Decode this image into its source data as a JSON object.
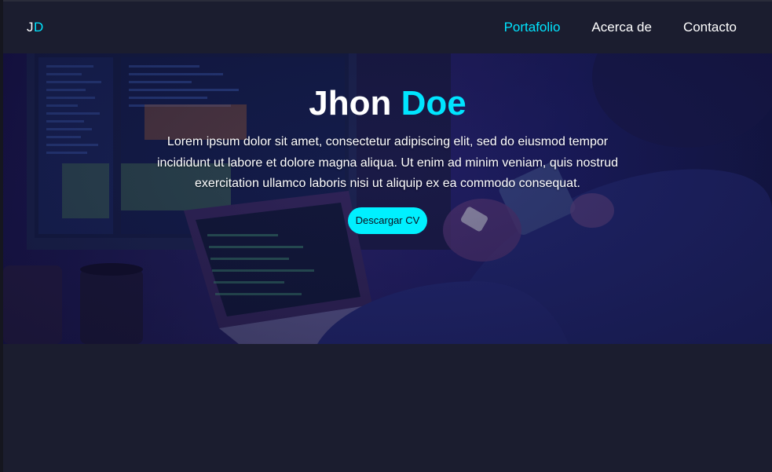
{
  "nav": {
    "logo_first": "J",
    "logo_second": "D",
    "links": [
      {
        "label": "Portafolio",
        "active": true
      },
      {
        "label": "Acerca de",
        "active": false
      },
      {
        "label": "Contacto",
        "active": false
      }
    ]
  },
  "hero": {
    "name_first": "Jhon",
    "name_last": "Doe",
    "description": "Lorem ipsum dolor sit amet, consectetur adipiscing elit, sed do eiusmod tempor incididunt ut labore et dolore magna aliqua. Ut enim ad minim veniam, quis nostrud exercitation ullamco laboris nisi ut aliquip ex ea commodo consequat.",
    "button_label": "Descargar CV"
  },
  "colors": {
    "background": "#1b1d2f",
    "accent": "#00e5ff",
    "button": "#00f0ff"
  }
}
